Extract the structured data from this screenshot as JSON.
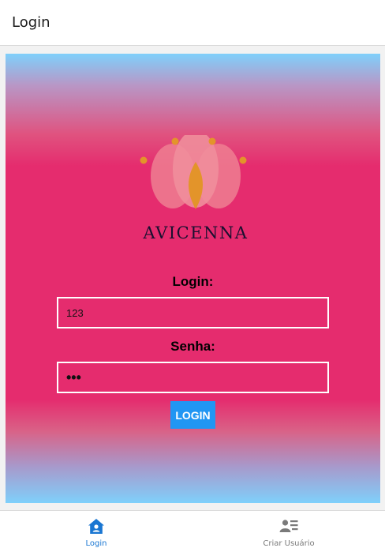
{
  "header": {
    "title": "Login"
  },
  "logo": {
    "brand": "AVICENNA"
  },
  "form": {
    "login_label": "Login:",
    "login_value": "123",
    "password_label": "Senha:",
    "password_value": "•••",
    "submit_label": "LOGIN"
  },
  "bottom_nav": {
    "items": [
      {
        "label": "Login",
        "icon": "home-user-icon",
        "active": true
      },
      {
        "label": "Criar Usuário",
        "icon": "person-list-icon",
        "active": false
      }
    ]
  },
  "colors": {
    "accent": "#e52c6e",
    "gradient_edge": "#7fd0fb",
    "button": "#2196f3",
    "active_nav": "#1976d2",
    "inactive_nav": "#7a7a7a",
    "logo_petal": "#ee7f92",
    "logo_center": "#e3942a"
  }
}
